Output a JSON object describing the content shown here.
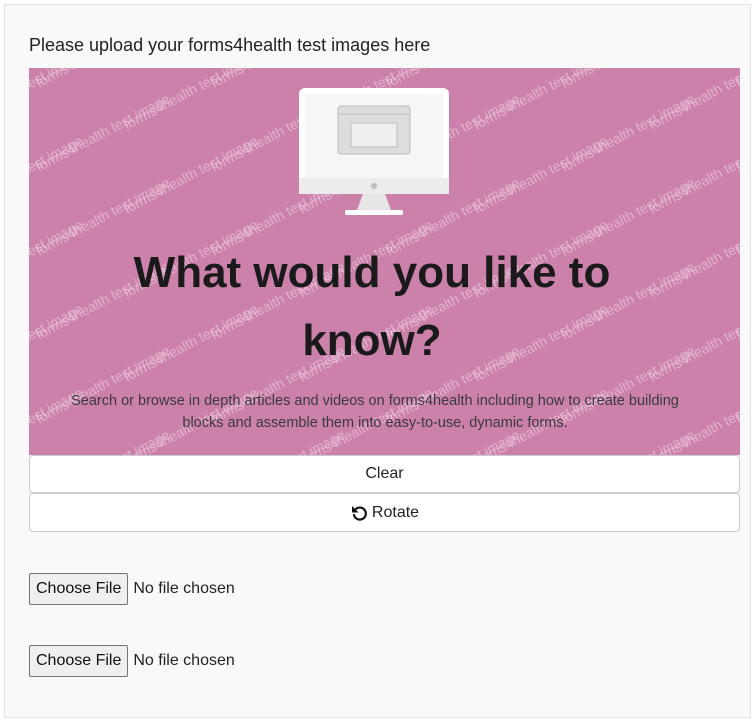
{
  "form": {
    "heading": "Please upload your forms4health test images here"
  },
  "preview_image": {
    "watermark_text": "forms4health test image",
    "headline_line1": "What would you like to",
    "headline_line2": "know?",
    "body_line1": "Search or browse in depth articles and videos on forms4health including how to create building",
    "body_line2": "blocks and assemble them into easy-to-use, dynamic forms.",
    "background_color": "#cc81ab",
    "icon": "computer-monitor-icon"
  },
  "buttons": {
    "clear_label": "Clear",
    "rotate_label": "Rotate",
    "rotate_icon": "rotate-left-icon"
  },
  "file_inputs": [
    {
      "button_label": "Choose File",
      "status": "No file chosen"
    },
    {
      "button_label": "Choose File",
      "status": "No file chosen"
    }
  ]
}
